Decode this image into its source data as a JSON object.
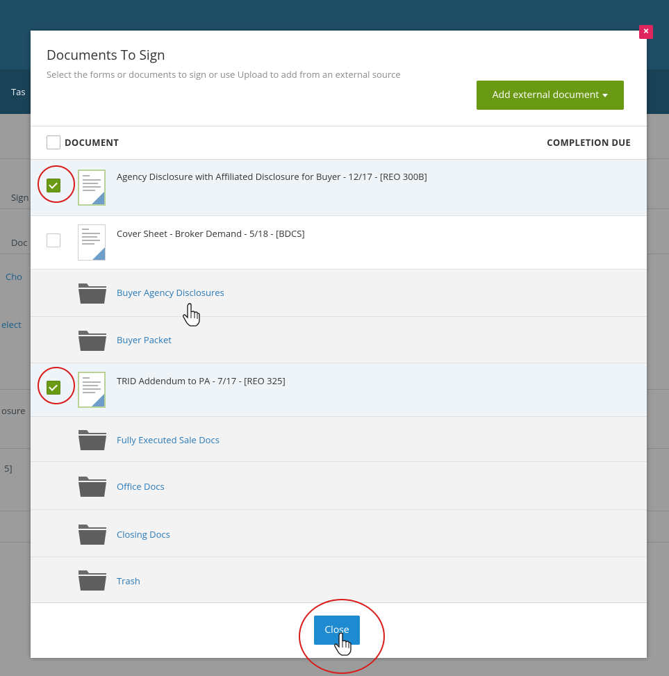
{
  "background": {
    "fragments": [
      "Tas",
      "Sign",
      "Doc",
      "Cho",
      "elect",
      "osure",
      "5]"
    ]
  },
  "modal": {
    "title": "Documents To Sign",
    "subtitle": "Select the forms or documents to sign or use Upload to add from an external source",
    "add_button": "Add external document",
    "close_x": "×",
    "table": {
      "col_document": "DOCUMENT",
      "col_due": "COMPLETION DUE"
    },
    "rows": [
      {
        "kind": "document",
        "title": "Agency Disclosure with Affiliated Disclosure for Buyer - 12/17 - [REO 300B]",
        "checked": true
      },
      {
        "kind": "document",
        "title": "Cover Sheet - Broker Demand - 5/18 - [BDCS]",
        "checked": false
      },
      {
        "kind": "folder",
        "title": "Buyer Agency Disclosures"
      },
      {
        "kind": "folder",
        "title": "Buyer Packet"
      },
      {
        "kind": "document",
        "title": "TRID Addendum to PA - 7/17 - [REO 325]",
        "checked": true
      },
      {
        "kind": "folder",
        "title": "Fully Executed Sale Docs"
      },
      {
        "kind": "folder",
        "title": "Office Docs"
      },
      {
        "kind": "folder",
        "title": "Closing Docs"
      },
      {
        "kind": "folder",
        "title": "Trash"
      }
    ],
    "close_button": "Close"
  },
  "colors": {
    "accent_green": "#6a9a13",
    "link_blue": "#2a7ab8",
    "close_blue": "#1e8bd0",
    "close_x_red": "#e0245e",
    "annotation_red": "#d81b1b"
  }
}
